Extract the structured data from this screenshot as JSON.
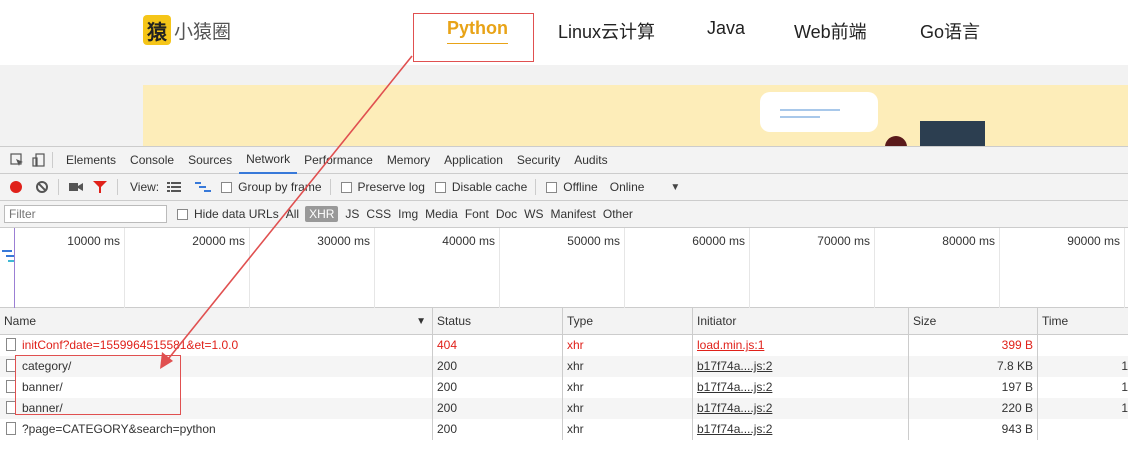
{
  "site": {
    "logo_char": "猿",
    "logo_text": "小猿圈",
    "nav": [
      "Python",
      "Linux云计算",
      "Java",
      "Web前端",
      "Go语言"
    ]
  },
  "devtools": {
    "tabs": [
      "Elements",
      "Console",
      "Sources",
      "Network",
      "Performance",
      "Memory",
      "Application",
      "Security",
      "Audits"
    ],
    "active_tab": "Network",
    "toolbar": {
      "view_label": "View:",
      "group_by_frame": "Group by frame",
      "preserve_log": "Preserve log",
      "disable_cache": "Disable cache",
      "offline": "Offline",
      "throttle": "Online"
    },
    "filter": {
      "placeholder": "Filter",
      "hide_data_urls": "Hide data URLs",
      "types": [
        "All",
        "XHR",
        "JS",
        "CSS",
        "Img",
        "Media",
        "Font",
        "Doc",
        "WS",
        "Manifest",
        "Other"
      ],
      "selected_type": "XHR"
    },
    "timeline_ticks": [
      "10000 ms",
      "20000 ms",
      "30000 ms",
      "40000 ms",
      "50000 ms",
      "60000 ms",
      "70000 ms",
      "80000 ms",
      "90000 ms"
    ],
    "columns": [
      "Name",
      "Status",
      "Type",
      "Initiator",
      "Size",
      "Time"
    ],
    "rows": [
      {
        "name": "initConf?date=1559964515581&et=1.0.0",
        "status": "404",
        "type": "xhr",
        "initiator": "load.min.js:1",
        "size": "399 B",
        "error": true
      },
      {
        "name": "category/",
        "status": "200",
        "type": "xhr",
        "initiator": "b17f74a....js:2",
        "size": "7.8 KB",
        "error": false
      },
      {
        "name": "banner/",
        "status": "200",
        "type": "xhr",
        "initiator": "b17f74a....js:2",
        "size": "197 B",
        "error": false
      },
      {
        "name": "banner/",
        "status": "200",
        "type": "xhr",
        "initiator": "b17f74a....js:2",
        "size": "220 B",
        "error": false
      },
      {
        "name": "?page=CATEGORY&search=python",
        "status": "200",
        "type": "xhr",
        "initiator": "b17f74a....js:2",
        "size": "943 B",
        "error": false
      }
    ]
  },
  "colors": {
    "accent": "#e8a317",
    "annotation": "#e05050",
    "error": "#e0211a",
    "active_tab": "#3879d9"
  }
}
